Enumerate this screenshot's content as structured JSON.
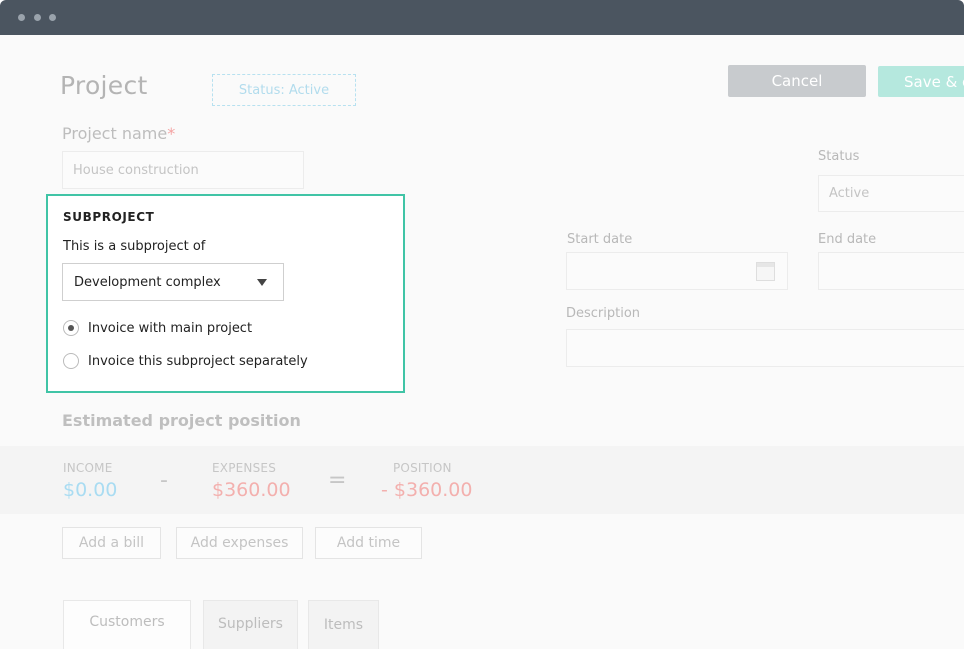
{
  "window": {
    "controls": [
      "close-dot",
      "minimize-dot",
      "maximize-dot"
    ]
  },
  "header": {
    "title": "Project",
    "status_badge": "Status: Active",
    "cancel_label": "Cancel",
    "save_label": "Save & close"
  },
  "form": {
    "project_name_label": "Project name",
    "required_mark": "*",
    "project_name_value": "House construction",
    "status_label": "Status",
    "status_value": "Active",
    "start_date_label": "Start date",
    "end_date_label": "End date",
    "description_label": "Description"
  },
  "subproject": {
    "title": "SUBPROJECT",
    "subtitle": "This is a subproject of",
    "selected_parent": "Development complex",
    "options": [
      {
        "label": "Invoice with main project",
        "selected": true
      },
      {
        "label": "Invoice this subproject separately",
        "selected": false
      }
    ]
  },
  "position": {
    "title": "Estimated project position",
    "income_label": "INCOME",
    "income_value": "$0.00",
    "minus_sign": "-",
    "expenses_label": "EXPENSES",
    "expenses_value": "$360.00",
    "equals_sign": "=",
    "position_label": "POSITION",
    "position_value": "- $360.00"
  },
  "actions": {
    "add_bill": "Add a bill",
    "add_expenses": "Add expenses",
    "add_time": "Add time"
  },
  "tabs": [
    "Customers",
    "Suppliers",
    "Items"
  ],
  "colors": {
    "accent": "#40c4a6",
    "income": "#a9dcf2",
    "expense": "#f3b0ae",
    "cancel_bg": "#c8cbce",
    "save_bg": "#b5e8de",
    "titlebar": "#4b5560"
  },
  "icons": {
    "calendar": "calendar-icon",
    "dropdown": "chevron-down-icon"
  }
}
